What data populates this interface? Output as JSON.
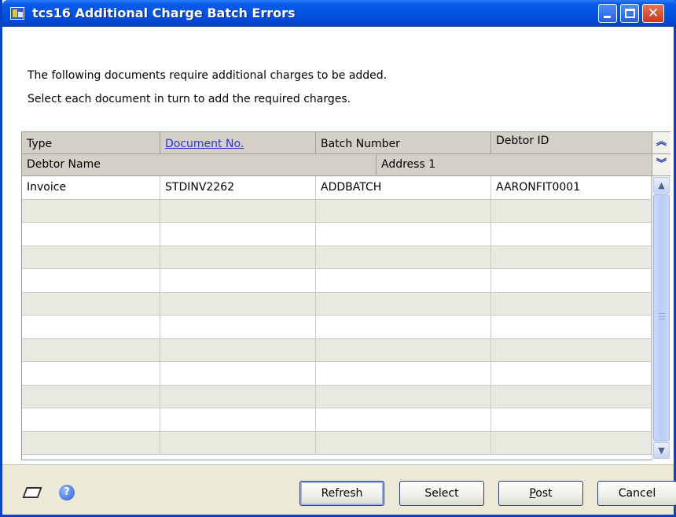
{
  "window": {
    "title": "tcs16 Additional Charge Batch Errors",
    "close_glyph": "✕"
  },
  "intro": {
    "line1": "The following documents require additional charges to be added.",
    "line2": "Select each document in turn to add the required charges."
  },
  "grid": {
    "header_row1": {
      "type": "Type",
      "document_no": "Document No.",
      "batch_number": "Batch Number",
      "debtor_id": "Debtor ID"
    },
    "header_row2": {
      "debtor_name": "Debtor Name",
      "address1": "Address 1"
    },
    "rows": [
      {
        "type": "Invoice",
        "document_no": "STDINV2262",
        "batch_number": "ADDBATCH",
        "debtor_id": "AARONFIT0001"
      },
      {
        "type": "",
        "document_no": "",
        "batch_number": "",
        "debtor_id": ""
      },
      {
        "type": "",
        "document_no": "",
        "batch_number": "",
        "debtor_id": ""
      },
      {
        "type": "",
        "document_no": "",
        "batch_number": "",
        "debtor_id": ""
      },
      {
        "type": "",
        "document_no": "",
        "batch_number": "",
        "debtor_id": ""
      },
      {
        "type": "",
        "document_no": "",
        "batch_number": "",
        "debtor_id": ""
      },
      {
        "type": "",
        "document_no": "",
        "batch_number": "",
        "debtor_id": ""
      },
      {
        "type": "",
        "document_no": "",
        "batch_number": "",
        "debtor_id": ""
      },
      {
        "type": "",
        "document_no": "",
        "batch_number": "",
        "debtor_id": ""
      },
      {
        "type": "",
        "document_no": "",
        "batch_number": "",
        "debtor_id": ""
      },
      {
        "type": "",
        "document_no": "",
        "batch_number": "",
        "debtor_id": ""
      },
      {
        "type": "",
        "document_no": "",
        "batch_number": "",
        "debtor_id": ""
      }
    ],
    "expand_glyph": "≈",
    "collapse_glyph": "≈"
  },
  "footer": {
    "refresh_label": "Refresh",
    "select_label": "Select",
    "post_label": "Post",
    "cancel_label": "Cancel",
    "help_glyph": "?"
  },
  "icons": {
    "window": "window-icon",
    "note": "note-icon",
    "help": "help-icon"
  }
}
